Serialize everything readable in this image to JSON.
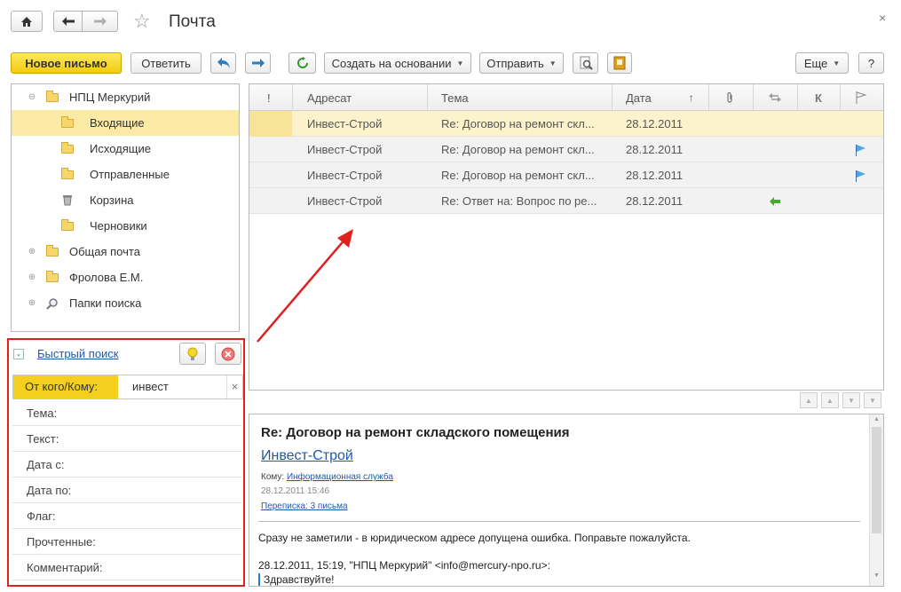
{
  "window": {
    "title": "Почта"
  },
  "toolbar": {
    "new_letter": "Новое письмо",
    "reply": "Ответить",
    "create_based_on": "Создать на основании",
    "send": "Отправить",
    "more": "Еще",
    "help": "?"
  },
  "tree": {
    "root": "НПЦ Меркурий",
    "items": [
      {
        "label": "Входящие",
        "icon": "folder-icon"
      },
      {
        "label": "Исходящие",
        "icon": "folder-icon"
      },
      {
        "label": "Отправленные",
        "icon": "folder-icon"
      },
      {
        "label": "Корзина",
        "icon": "trash-icon"
      },
      {
        "label": "Черновики",
        "icon": "draft-folder-icon"
      }
    ],
    "other": [
      {
        "label": "Общая почта",
        "icon": "folder-icon"
      },
      {
        "label": "Фролова Е.М.",
        "icon": "folder-icon"
      },
      {
        "label": "Папки поиска",
        "icon": "search-icon"
      }
    ]
  },
  "grid": {
    "columns": {
      "importance": "!",
      "addressee": "Адресат",
      "subject": "Тема",
      "date": "Дата",
      "sort_arrow": "↑",
      "k": "К"
    },
    "rows": [
      {
        "addressee": "Инвест-Строй",
        "subject": "Re: Договор на ремонт скл...",
        "date": "28.12.2011",
        "flag": false,
        "reply": false
      },
      {
        "addressee": "Инвест-Строй",
        "subject": "Re: Договор на ремонт скл...",
        "date": "28.12.2011",
        "flag": true,
        "reply": false
      },
      {
        "addressee": "Инвест-Строй",
        "subject": "Re: Договор на ремонт скл...",
        "date": "28.12.2011",
        "flag": true,
        "reply": false
      },
      {
        "addressee": "Инвест-Строй",
        "subject": "Re: Ответ на: Вопрос по ре...",
        "date": "28.12.2011",
        "flag": false,
        "reply": true
      }
    ]
  },
  "quick_search": {
    "title": "Быстрый поиск",
    "from_to_label": "От кого/Кому:",
    "from_to_value": "инвест",
    "clear": "×",
    "fields": [
      "Тема:",
      "Текст:",
      "Дата с:",
      "Дата по:",
      "Флаг:",
      "Прочтенные:",
      "Комментарий:"
    ]
  },
  "preview": {
    "subject": "Re: Договор на ремонт складского помещения",
    "sender": "Инвест-Строй",
    "to_label": "Кому:",
    "to_value": "Информационная служба",
    "datetime": "28.12.2011 15:46",
    "thread": "Переписка: 3 письма",
    "body": "Сразу не заметили - в юридическом адресе допущена ошибка. Поправьте пожалуйста.",
    "quote_header": "28.12.2011, 15:19, \"НПЦ Меркурий\" <info@mercury-npo.ru>:",
    "quote_line": "Здравствуйте!"
  },
  "colors": {
    "primary_button": "#f2cc12",
    "selection": "#fbeaa3",
    "highlight_border": "#e0201f",
    "link": "#1f5aa8",
    "flag": "#4da6e6"
  }
}
